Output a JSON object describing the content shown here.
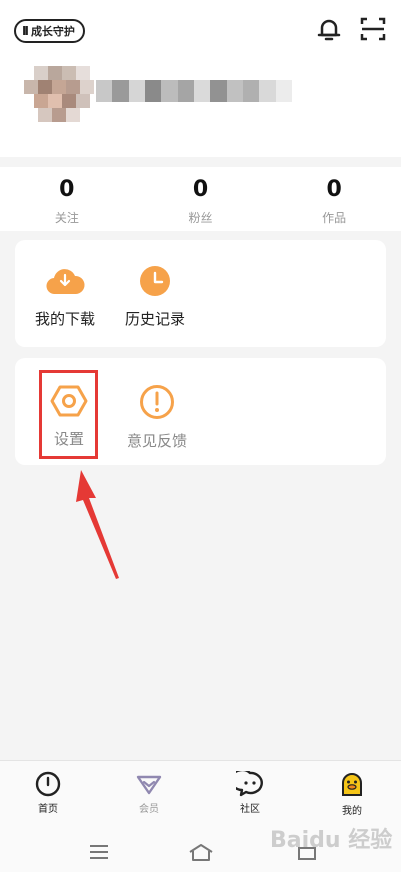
{
  "header": {
    "guard_label": "成长守护",
    "guard_icon": "growth-guard-icon",
    "bell_icon": "bell-icon",
    "scan_icon": "scan-icon"
  },
  "stats": [
    {
      "value": "0",
      "label": "关注"
    },
    {
      "value": "0",
      "label": "粉丝"
    },
    {
      "value": "0",
      "label": "作品"
    }
  ],
  "card1": {
    "items": [
      {
        "label": "我的下载",
        "icon": "cloud-download-icon"
      },
      {
        "label": "历史记录",
        "icon": "clock-icon"
      }
    ]
  },
  "card2": {
    "items": [
      {
        "label": "设置",
        "icon": "settings-hexagon-icon"
      },
      {
        "label": "意见反馈",
        "icon": "exclamation-icon"
      }
    ]
  },
  "tabbar": {
    "tabs": [
      {
        "label": "首页",
        "icon": "home-icon"
      },
      {
        "label": "会员",
        "icon": "vip-diamond-icon"
      },
      {
        "label": "社区",
        "icon": "chat-bubble-icon"
      },
      {
        "label": "我的",
        "icon": "duck-icon"
      }
    ]
  },
  "watermark": "Baidu 经验",
  "colors": {
    "accent_orange": "#f6a24a",
    "highlight_red": "#e53935",
    "tab_active": "#f5c518"
  }
}
